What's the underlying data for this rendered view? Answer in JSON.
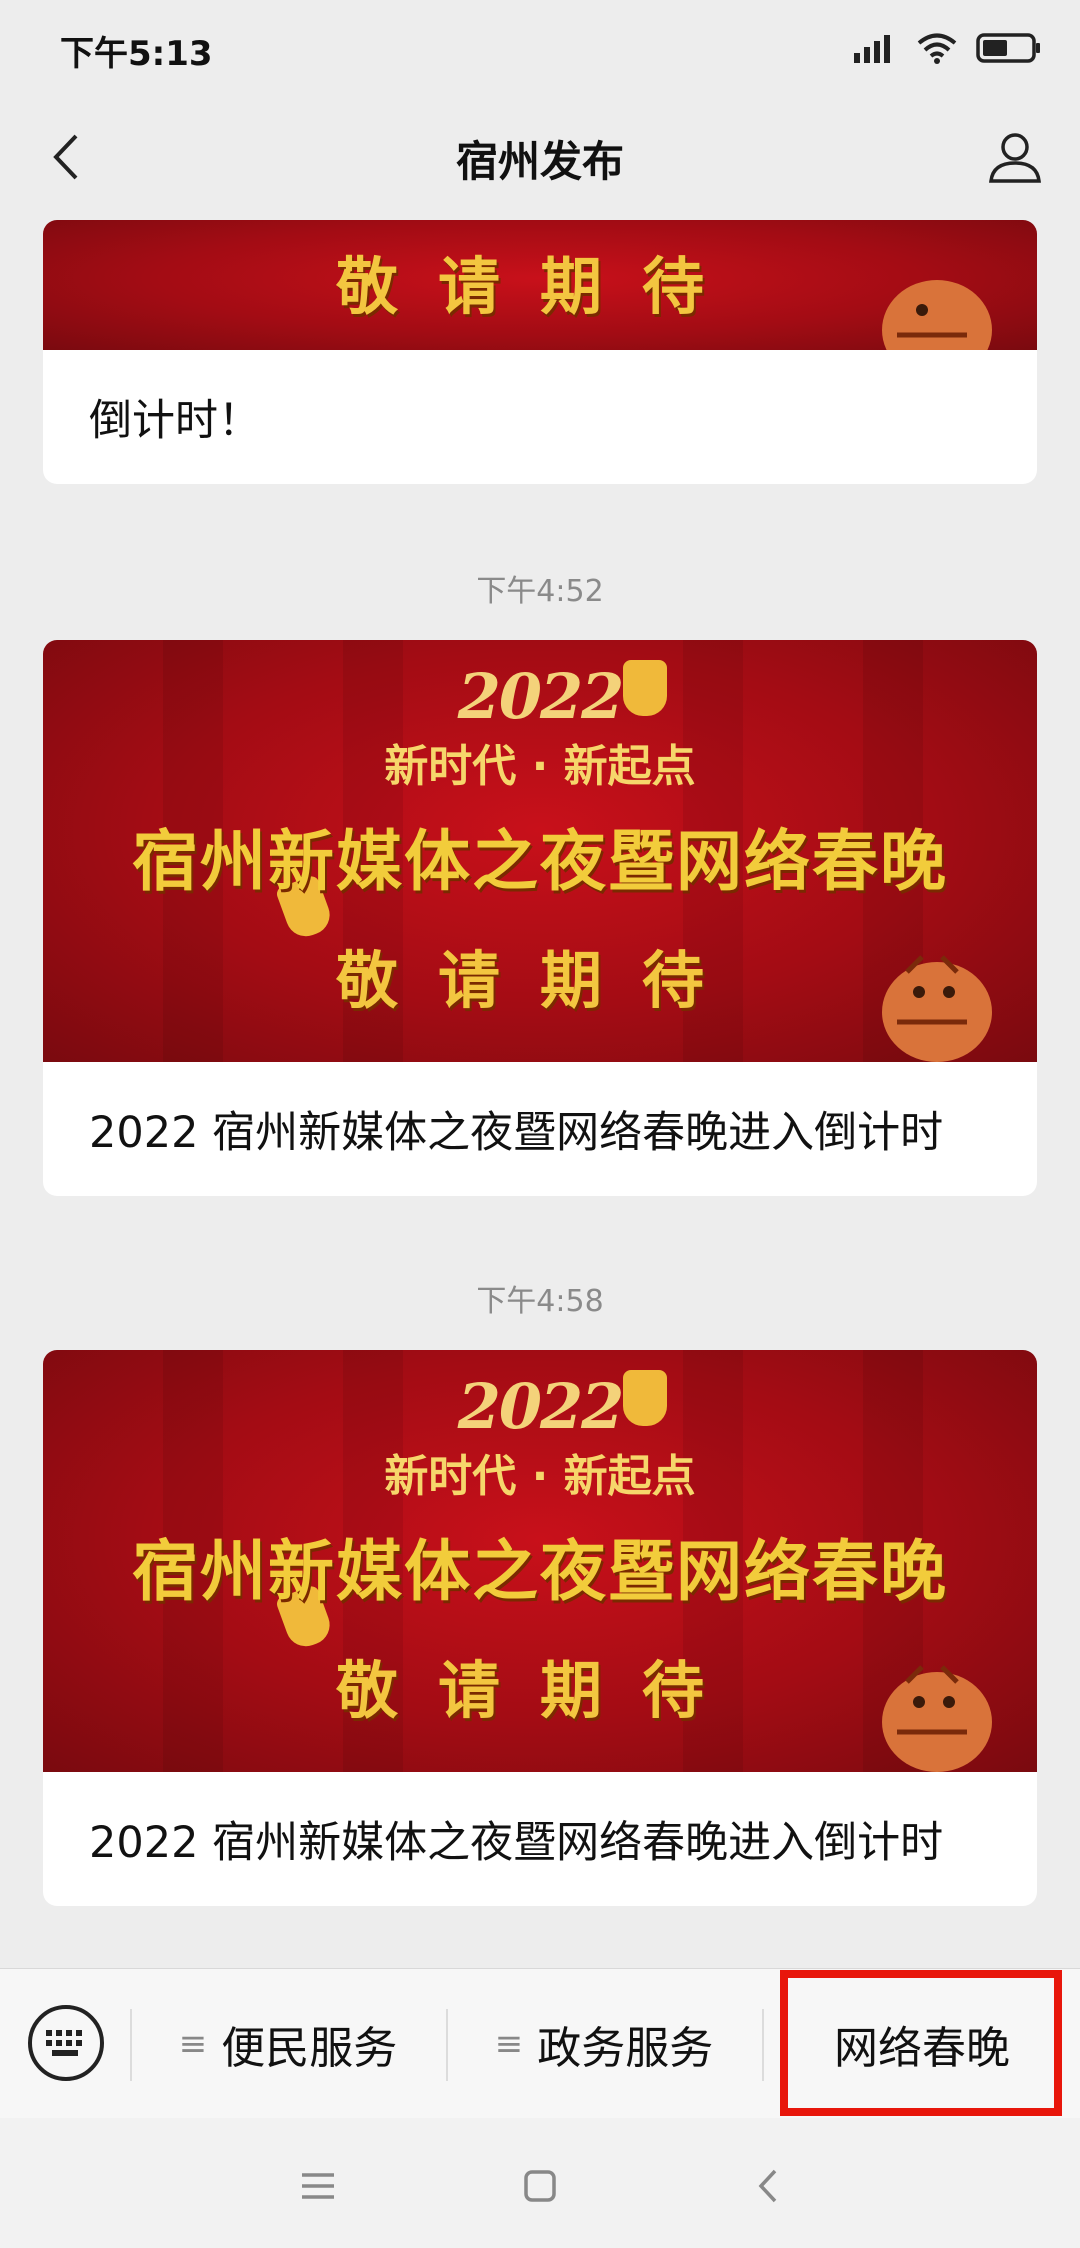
{
  "status": {
    "time": "下午5:13"
  },
  "nav": {
    "title": "宿州发布"
  },
  "feed": {
    "top_card": {
      "image_text": "敬请期待",
      "caption": "倒计时！"
    },
    "messages": [
      {
        "timestamp": "下午4:52",
        "image": {
          "year": "2022",
          "slogan": "新时代 · 新起点",
          "headline": "宿州新媒体之夜暨网络春晚",
          "sub": "敬请期待"
        },
        "caption": "2022 宿州新媒体之夜暨网络春晚进入倒计时"
      },
      {
        "timestamp": "下午4:58",
        "image": {
          "year": "2022",
          "slogan": "新时代 · 新起点",
          "headline": "宿州新媒体之夜暨网络春晚",
          "sub": "敬请期待"
        },
        "caption": "2022 宿州新媒体之夜暨网络春晚进入倒计时"
      }
    ]
  },
  "menu": {
    "items": [
      {
        "label": "便民服务",
        "icon": "list-icon"
      },
      {
        "label": "政务服务",
        "icon": "list-icon"
      },
      {
        "label": "网络春晚"
      }
    ]
  },
  "colors": {
    "highlight": "#e8160b",
    "banner_red": "#b50d16",
    "gold": "#f2cc3b"
  }
}
